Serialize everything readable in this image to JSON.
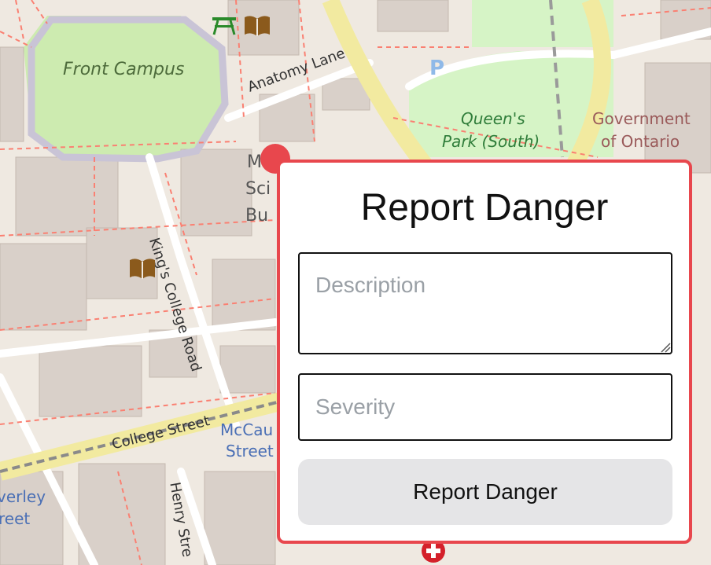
{
  "map": {
    "labels": {
      "front_campus": "Front Campus",
      "anatomy_lane": "Anatomy Lane",
      "kings_college_road": "King's College Road",
      "college_street": "College Street",
      "henry_street": "Henry Stre",
      "mccaul_1": "McCau",
      "mccaul_2": "Street",
      "beverley_1": "verley",
      "beverley_2": "reet",
      "queens_park_1": "Queen's",
      "queens_park_2": "Park (South)",
      "government_1": "Government",
      "government_2": "of Ontario",
      "building_1": "M",
      "building_2": "Sci",
      "building_3": "Bu",
      "parking": "P"
    },
    "icons": [
      "picnic-table-icon",
      "library-icon",
      "parking-icon",
      "hospital-icon"
    ],
    "colors": {
      "land": "#efe9e1",
      "building": "#d9d0c9",
      "park": "#cdebb0",
      "road_primary": "#f8f1a6",
      "road_path": "#fa8072"
    }
  },
  "popup": {
    "title": "Report Danger",
    "description_placeholder": "Description",
    "description_value": "",
    "severity_placeholder": "Severity",
    "severity_value": "",
    "submit_label": "Report Danger",
    "accent_color": "#e8474d"
  }
}
